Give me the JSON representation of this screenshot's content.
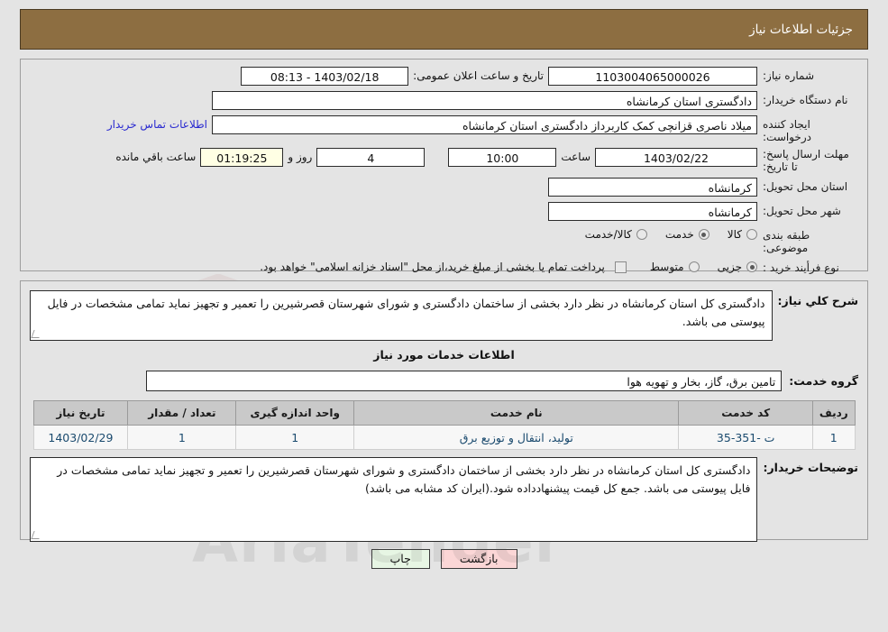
{
  "header": {
    "title": "جزئیات اطلاعات نیاز"
  },
  "top_form": {
    "need_number": {
      "label": "شماره نیاز:",
      "value": "1103004065000026"
    },
    "announce_datetime": {
      "label": "تاریخ و ساعت اعلان عمومی:",
      "value": "1403/02/18 - 08:13"
    },
    "buyer_org": {
      "label": "نام دستگاه خریدار:",
      "value": "دادگستری استان کرمانشاه"
    },
    "request_creator": {
      "label": "ایجاد کننده درخواست:",
      "value": "میلاد ناصری قزانچی کمک کاربرداز دادگستری استان کرمانشاه"
    },
    "contact_link": "اطلاعات تماس خریدار",
    "deadline": {
      "label": "مهلت ارسال پاسخ: تا تاریخ:",
      "date": "1403/02/22",
      "hour_label": "ساعت",
      "hour": "10:00",
      "days": "4",
      "days_label": "روز و",
      "timer": "01:19:25",
      "timer_label": "ساعت باقي مانده"
    },
    "delivery_province": {
      "label": "استان محل تحویل:",
      "value": "کرمانشاه"
    },
    "delivery_city": {
      "label": "شهر محل تحویل:",
      "value": "کرمانشاه"
    },
    "category": {
      "label": "طبقه بندی موضوعی:",
      "options": [
        {
          "label": "کالا",
          "selected": false
        },
        {
          "label": "خدمت",
          "selected": true
        },
        {
          "label": "کالا/خدمت",
          "selected": false
        }
      ]
    },
    "purchase_type": {
      "label": "نوع فرأیند خرید :",
      "options": [
        {
          "label": "جزیی",
          "selected": true
        },
        {
          "label": "متوسط",
          "selected": false
        }
      ],
      "checkbox_checked": false,
      "checkbox_text": "پرداخت تمام یا بخشی از مبلغ خرید،از محل \"اسناد خزانه اسلامی\" خواهد بود."
    }
  },
  "summary": {
    "label": "شرح کلي نیاز:",
    "text": "دادگستری کل استان کرمانشاه در نظر دارد بخشی از ساختمان دادگستری و شورای شهرستان قصرشیرین را تعمیر و تجهیز نماید تمامی مشخصات در فایل پیوستی می باشد."
  },
  "services_section": {
    "title": "اطلاعات خدمات مورد نیاز",
    "service_group": {
      "label": "گروه خدمت:",
      "value": "تامین برق، گاز، بخار و تهویه هوا"
    },
    "table": {
      "columns": [
        "ردیف",
        "کد خدمت",
        "نام خدمت",
        "واحد اندازه گیری",
        "تعداد / مقدار",
        "تاریخ نیاز"
      ],
      "rows": [
        {
          "row": "1",
          "code": "ت -351-35",
          "name": "تولید، انتقال و توزیع برق",
          "unit": "1",
          "quantity": "1",
          "need_date": "1403/02/29"
        }
      ]
    }
  },
  "buyer_notes": {
    "label": "توضیحات خریدار:",
    "text": "دادگستری کل استان کرمانشاه در نظر دارد بخشی از ساختمان دادگستری و شورای شهرستان قصرشیرین را تعمیر و تجهیز نماید تمامی مشخصات در فایل پیوستی می باشد. جمع کل قیمت پیشنهادداده شود.(ایران کد مشابه می باشد)"
  },
  "footer": {
    "print_button": "چاپ",
    "back_button": "بازگشت"
  },
  "watermark": {
    "main": "AriaTender",
    "sub": ".net"
  },
  "colors": {
    "header_bg": "#8d6e41",
    "page_bg": "#e4e4e4",
    "link": "#2a2ad0",
    "timer_bg": "#ffffe4",
    "print_btn_bg": "#e7f6e4",
    "back_btn_bg": "#fbd6d6"
  }
}
